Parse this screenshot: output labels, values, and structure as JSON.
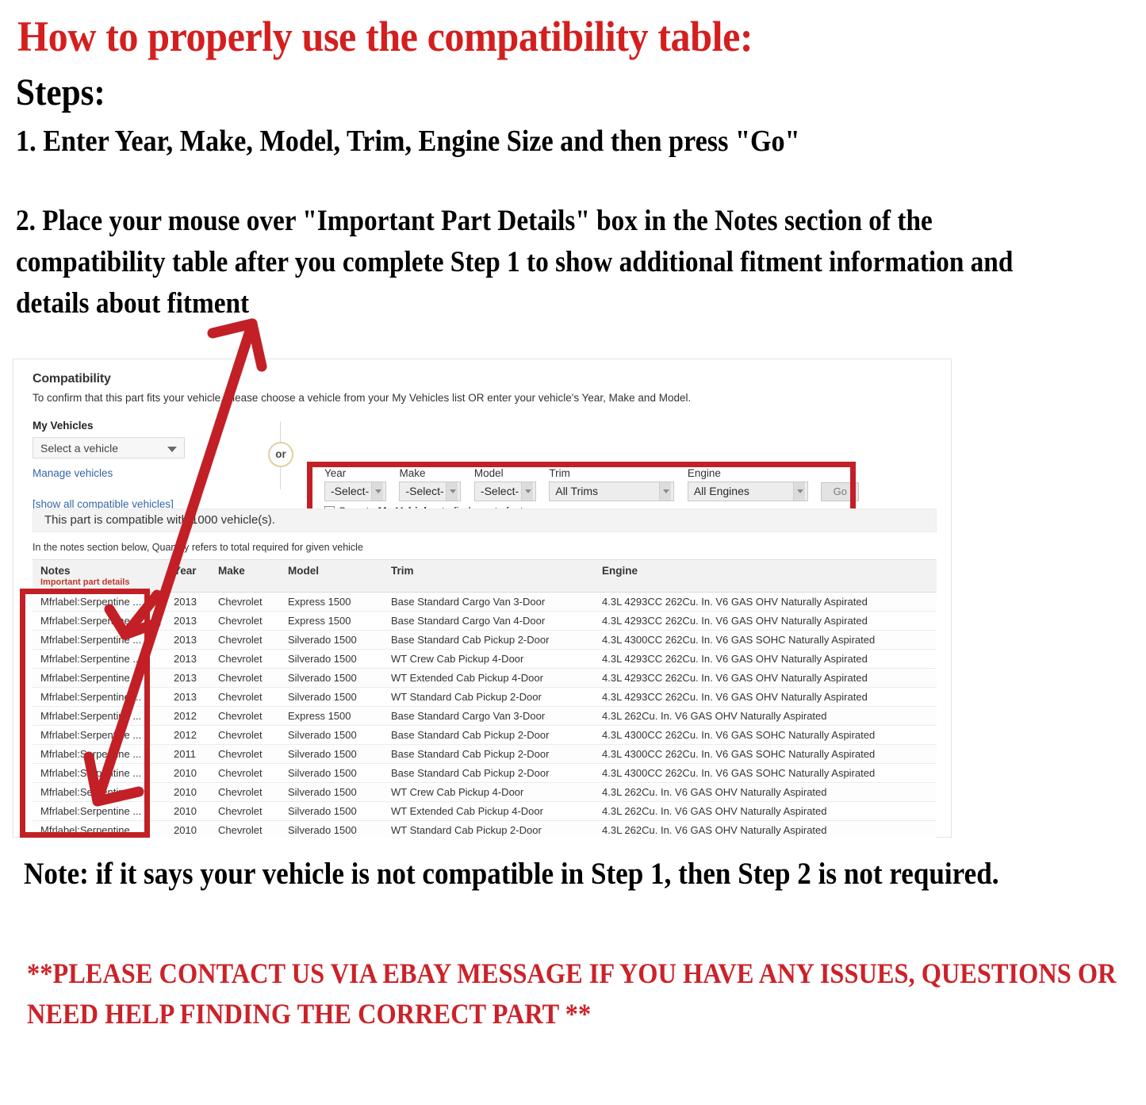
{
  "headings": {
    "title": "How to properly use the compatibility table:",
    "steps_label": "Steps:",
    "step1": "1. Enter Year, Make, Model, Trim, Engine Size and then press \"Go\"",
    "step2": "2. Place your mouse over \"Important Part Details\" box in the Notes section of the compatibility table after you complete Step 1 to show additional fitment information and details about fitment",
    "note": "Note: if it says your vehicle is not compatible in Step 1, then Step 2 is not required.",
    "contact": "**PLEASE CONTACT US VIA EBAY MESSAGE IF YOU HAVE ANY ISSUES, QUESTIONS OR NEED HELP FINDING THE CORRECT PART **"
  },
  "colors": {
    "heading_red": "#d41f1f",
    "contact_red": "#cc2229",
    "highlight_box_red": "#c22026",
    "link_blue": "#3665a6",
    "notes_sub_red": "#c0392b"
  },
  "panel": {
    "title": "Compatibility",
    "subtitle": "To confirm that this part fits your vehicle, please choose a vehicle from your My Vehicles list OR enter your vehicle's Year, Make and Model.",
    "my_vehicles_label": "My Vehicles",
    "vehicle_select_value": "Select a vehicle",
    "manage_vehicles_link": "Manage vehicles",
    "show_all_link": "[show all compatible vehicles]",
    "or_label": "or",
    "count_message": "This part is compatible with 1000 vehicle(s).",
    "qty_note": "In the notes section below, Quantity refers to total required for given vehicle"
  },
  "form": {
    "fields": [
      {
        "label": "Year",
        "value": "-Select-"
      },
      {
        "label": "Make",
        "value": "-Select-"
      },
      {
        "label": "Model",
        "value": "-Select-"
      },
      {
        "label": "Trim",
        "value": "All Trims"
      },
      {
        "label": "Engine",
        "value": "All Engines"
      }
    ],
    "go_label": "Go",
    "save_prefix": "Save to ",
    "save_bold": "My Vehicles",
    "save_suffix": " to finds parts faster",
    "save_checked": true
  },
  "table": {
    "headers": {
      "notes": "Notes",
      "notes_sub": "Important part details",
      "year": "Year",
      "make": "Make",
      "model": "Model",
      "trim": "Trim",
      "engine": "Engine"
    },
    "rows": [
      {
        "notes": "Mfrlabel:Serpentine ...",
        "year": "2013",
        "make": "Chevrolet",
        "model": "Express 1500",
        "trim": "Base Standard Cargo Van 3-Door",
        "engine": "4.3L 4293CC 262Cu. In. V6 GAS OHV Naturally Aspirated"
      },
      {
        "notes": "Mfrlabel:Serpentine ...",
        "year": "2013",
        "make": "Chevrolet",
        "model": "Express 1500",
        "trim": "Base Standard Cargo Van 4-Door",
        "engine": "4.3L 4293CC 262Cu. In. V6 GAS OHV Naturally Aspirated"
      },
      {
        "notes": "Mfrlabel:Serpentine ...",
        "year": "2013",
        "make": "Chevrolet",
        "model": "Silverado 1500",
        "trim": "Base Standard Cab Pickup 2-Door",
        "engine": "4.3L 4300CC 262Cu. In. V6 GAS SOHC Naturally Aspirated"
      },
      {
        "notes": "Mfrlabel:Serpentine ...",
        "year": "2013",
        "make": "Chevrolet",
        "model": "Silverado 1500",
        "trim": "WT Crew Cab Pickup 4-Door",
        "engine": "4.3L 4293CC 262Cu. In. V6 GAS OHV Naturally Aspirated"
      },
      {
        "notes": "Mfrlabel:Serpentine ...",
        "year": "2013",
        "make": "Chevrolet",
        "model": "Silverado 1500",
        "trim": "WT Extended Cab Pickup 4-Door",
        "engine": "4.3L 4293CC 262Cu. In. V6 GAS OHV Naturally Aspirated"
      },
      {
        "notes": "Mfrlabel:Serpentine ...",
        "year": "2013",
        "make": "Chevrolet",
        "model": "Silverado 1500",
        "trim": "WT Standard Cab Pickup 2-Door",
        "engine": "4.3L 4293CC 262Cu. In. V6 GAS OHV Naturally Aspirated"
      },
      {
        "notes": "Mfrlabel:Serpentine ...",
        "year": "2012",
        "make": "Chevrolet",
        "model": "Express 1500",
        "trim": "Base Standard Cargo Van 3-Door",
        "engine": "4.3L 262Cu. In. V6 GAS OHV Naturally Aspirated"
      },
      {
        "notes": "Mfrlabel:Serpentine ...",
        "year": "2012",
        "make": "Chevrolet",
        "model": "Silverado 1500",
        "trim": "Base Standard Cab Pickup 2-Door",
        "engine": "4.3L 4300CC 262Cu. In. V6 GAS SOHC Naturally Aspirated"
      },
      {
        "notes": "Mfrlabel:Serpentine ...",
        "year": "2011",
        "make": "Chevrolet",
        "model": "Silverado 1500",
        "trim": "Base Standard Cab Pickup 2-Door",
        "engine": "4.3L 4300CC 262Cu. In. V6 GAS SOHC Naturally Aspirated"
      },
      {
        "notes": "Mfrlabel:Serpentine ...",
        "year": "2010",
        "make": "Chevrolet",
        "model": "Silverado 1500",
        "trim": "Base Standard Cab Pickup 2-Door",
        "engine": "4.3L 4300CC 262Cu. In. V6 GAS SOHC Naturally Aspirated"
      },
      {
        "notes": "Mfrlabel:Serpentine ...",
        "year": "2010",
        "make": "Chevrolet",
        "model": "Silverado 1500",
        "trim": "WT Crew Cab Pickup 4-Door",
        "engine": "4.3L 262Cu. In. V6 GAS OHV Naturally Aspirated"
      },
      {
        "notes": "Mfrlabel:Serpentine ...",
        "year": "2010",
        "make": "Chevrolet",
        "model": "Silverado 1500",
        "trim": "WT Extended Cab Pickup 4-Door",
        "engine": "4.3L 262Cu. In. V6 GAS OHV Naturally Aspirated"
      },
      {
        "notes": "Mfrlabel:Serpentine ...",
        "year": "2010",
        "make": "Chevrolet",
        "model": "Silverado 1500",
        "trim": "WT Standard Cab Pickup 2-Door",
        "engine": "4.3L 262Cu. In. V6 GAS OHV Naturally Aspirated"
      }
    ]
  },
  "annotations": {
    "arrow_name": "red-annotation-arrow",
    "form_box_name": "red-highlight-box-form",
    "notes_box_name": "red-highlight-box-notes"
  }
}
